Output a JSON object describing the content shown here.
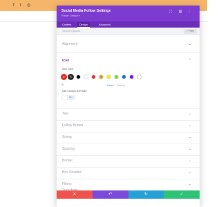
{
  "header": {
    "title": "Social Media Follow Settings",
    "preset": "Preset: Default ▾"
  },
  "tabs": [
    "Content",
    "Design",
    "Advanced"
  ],
  "search": {
    "placeholder": "Search Options",
    "filter_label": "+ Filter"
  },
  "sections": {
    "alignment": "Alignment",
    "icon": "Icon",
    "text": "Text",
    "follow_button": "Follow Button",
    "sizing": "Sizing",
    "spacing": "Spacing",
    "border": "Border",
    "box_shadow": "Box Shadow",
    "filters": "Filters",
    "transform": "Transform"
  },
  "icon_panel": {
    "icon_color_label": "Icon Color",
    "saved": "Saved",
    "recent": "Recent",
    "custom_size_label": "Use Custom Icon Size",
    "toggle_text": "NO",
    "swatches": [
      "#000000",
      "#ffffff",
      "#e02b20",
      "#e09900",
      "#edf000",
      "#7cda24",
      "#0c71c3",
      "#8300e9"
    ]
  },
  "footer": {
    "cancel": "✕",
    "undo": "↶",
    "redo": "↻",
    "save": "✓"
  },
  "colors": {
    "accent": "#7e3bd0",
    "topbar": "#f5b66a",
    "cancel": "#ef5350",
    "undo": "#7b4ad8",
    "redo": "#26a1d5",
    "save": "#2ec277"
  }
}
